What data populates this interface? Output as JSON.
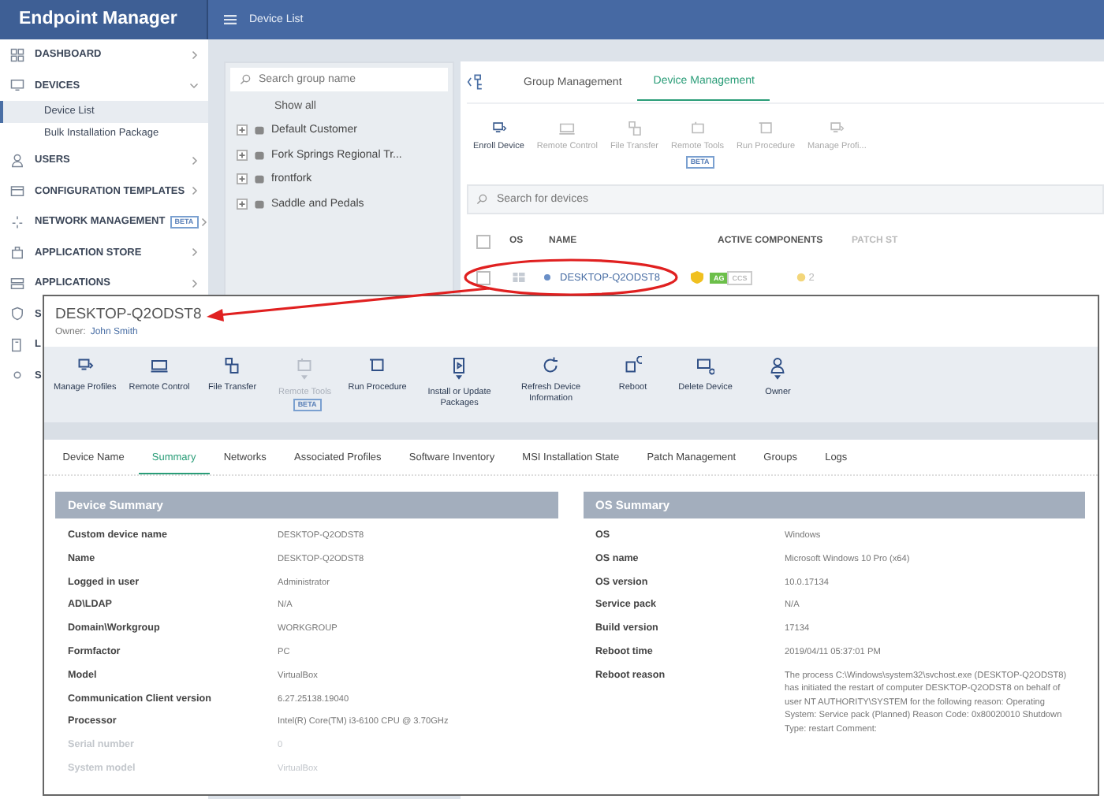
{
  "app": {
    "title": "Endpoint Manager"
  },
  "header": {
    "title": "Device List"
  },
  "sidebar": {
    "items": [
      {
        "label": "DASHBOARD",
        "expanded": false
      },
      {
        "label": "DEVICES",
        "expanded": true,
        "children": [
          {
            "label": "Device List",
            "selected": true
          },
          {
            "label": "Bulk Installation Package",
            "selected": false
          }
        ]
      },
      {
        "label": "USERS",
        "expanded": false
      },
      {
        "label": "CONFIGURATION TEMPLATES",
        "expanded": false
      },
      {
        "label": "NETWORK MANAGEMENT",
        "badge": "BETA",
        "expanded": false
      },
      {
        "label": "APPLICATION STORE",
        "expanded": false
      },
      {
        "label": "APPLICATIONS",
        "expanded": false
      },
      {
        "label": "S"
      },
      {
        "label": "L"
      },
      {
        "label": "S"
      }
    ]
  },
  "group_panel": {
    "search": {
      "placeholder": "Search group name"
    },
    "show_all": "Show all",
    "groups": [
      "Default Customer",
      "Fork Springs Regional Tr...",
      "frontfork",
      "Saddle and Pedals"
    ]
  },
  "device_panel": {
    "tabs": [
      {
        "label": "Group Management",
        "selected": false
      },
      {
        "label": "Device Management",
        "selected": true
      }
    ],
    "toolbar": [
      {
        "label": "Enroll Device",
        "disabled": false
      },
      {
        "label": "Remote Control",
        "disabled": true
      },
      {
        "label": "File Transfer",
        "disabled": true
      },
      {
        "label": "Remote Tools",
        "disabled": true,
        "badge": "BETA"
      },
      {
        "label": "Run Procedure",
        "disabled": true
      },
      {
        "label": "Manage Profi...",
        "disabled": true
      }
    ],
    "search": {
      "placeholder": "Search for devices"
    },
    "select_all": {
      "checked": false
    },
    "columns": [
      "OS",
      "NAME",
      "ACTIVE COMPONENTS",
      "PATCH ST"
    ],
    "rows": [
      {
        "name": "DESKTOP-Q2ODST8",
        "checked": false,
        "components": [
          "AG",
          "CCS"
        ],
        "patch": "2"
      }
    ]
  },
  "device_popup": {
    "title": "DESKTOP-Q2ODST8",
    "owner_label": "Owner:",
    "owner": "John Smith",
    "toolbar": [
      {
        "label": "Manage Profiles",
        "disabled": false,
        "dropdown": false
      },
      {
        "label": "Remote Control",
        "disabled": false,
        "dropdown": false
      },
      {
        "label": "File Transfer",
        "disabled": false,
        "dropdown": false
      },
      {
        "label": "Remote Tools",
        "disabled": true,
        "dropdown": true,
        "badge": "BETA"
      },
      {
        "label": "Run Procedure",
        "disabled": false,
        "dropdown": false
      },
      {
        "label": "Install or Update Packages",
        "disabled": false,
        "dropdown": true
      },
      {
        "label": "Refresh Device Information",
        "disabled": false,
        "dropdown": false
      },
      {
        "label": "Reboot",
        "disabled": false,
        "dropdown": false
      },
      {
        "label": "Delete Device",
        "disabled": false,
        "dropdown": false
      },
      {
        "label": "Owner",
        "disabled": false,
        "dropdown": true
      }
    ],
    "tabs": [
      {
        "label": "Device Name",
        "selected": false
      },
      {
        "label": "Summary",
        "selected": true
      },
      {
        "label": "Networks",
        "selected": false
      },
      {
        "label": "Associated Profiles",
        "selected": false
      },
      {
        "label": "Software Inventory",
        "selected": false
      },
      {
        "label": "MSI Installation State",
        "selected": false
      },
      {
        "label": "Patch Management",
        "selected": false
      },
      {
        "label": "Groups",
        "selected": false
      },
      {
        "label": "Logs",
        "selected": false
      }
    ],
    "device_summary": {
      "title": "Device Summary",
      "rows": [
        {
          "label": "Custom device name",
          "value": "DESKTOP-Q2ODST8",
          "faded": false
        },
        {
          "label": "Name",
          "value": "DESKTOP-Q2ODST8",
          "faded": false
        },
        {
          "label": "Logged in user",
          "value": "Administrator",
          "faded": false
        },
        {
          "label": "AD\\LDAP",
          "value": "N/A",
          "faded": false
        },
        {
          "label": "Domain\\Workgroup",
          "value": "WORKGROUP",
          "faded": false
        },
        {
          "label": "Formfactor",
          "value": "PC",
          "faded": false
        },
        {
          "label": "Model",
          "value": "VirtualBox",
          "faded": false
        },
        {
          "label": "Communication Client version",
          "value": "6.27.25138.19040",
          "faded": false
        },
        {
          "label": "Processor",
          "value": "Intel(R) Core(TM) i3-6100 CPU @ 3.70GHz",
          "faded": false
        },
        {
          "label": "Serial number",
          "value": "0",
          "faded": true
        },
        {
          "label": "System model",
          "value": "VirtualBox",
          "faded": true
        }
      ]
    },
    "os_summary": {
      "title": "OS Summary",
      "rows": [
        {
          "label": "OS",
          "value": "Windows"
        },
        {
          "label": "OS name",
          "value": "Microsoft Windows 10 Pro (x64)"
        },
        {
          "label": "OS version",
          "value": "10.0.17134"
        },
        {
          "label": "Service pack",
          "value": "N/A"
        },
        {
          "label": "Build version",
          "value": "17134"
        },
        {
          "label": "Reboot time",
          "value": "2019/04/11 05:37:01 PM"
        },
        {
          "label": "Reboot reason",
          "value": "The process C:\\Windows\\system32\\svchost.exe (DESKTOP-Q2ODST8) has initiated the restart of computer DESKTOP-Q2ODST8 on behalf of user NT AUTHORITY\\SYSTEM for the following reason: Operating System: Service pack (Planned) Reason Code: 0x80020010 Shutdown Type: restart Comment:"
        }
      ]
    }
  }
}
